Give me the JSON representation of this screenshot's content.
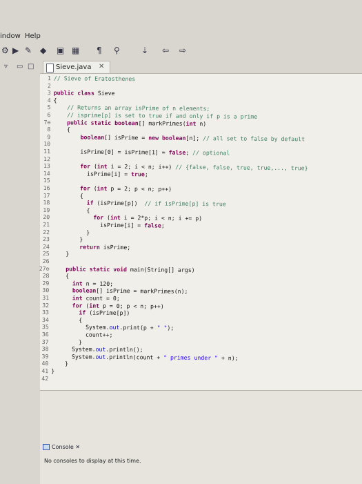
{
  "menu": {
    "window_label": "indow",
    "help_label": "Help"
  },
  "toolbar": {
    "icons": [
      "debug-icon",
      "run-icon",
      "new-icon",
      "pin-icon",
      "bookmark-icon",
      "pilcrow-icon",
      "search-icon",
      "annotation-icon",
      "back-icon",
      "forward-icon"
    ],
    "pilcrow": "¶"
  },
  "editor": {
    "tab_label": "Sieve.java",
    "tab_close": "✕"
  },
  "code_lines": [
    {
      "n": "1",
      "t": "// Sieve of Eratosthenes"
    },
    {
      "n": "2",
      "t": ""
    },
    {
      "n": "3",
      "t": "public class Sieve"
    },
    {
      "n": "4",
      "t": "{"
    },
    {
      "n": "5",
      "t": "    // Returns an array isPrime of n elements;"
    },
    {
      "n": "6",
      "t": "    // isprime[p] is set to true if and only if p is a prime"
    },
    {
      "n": "7⊖",
      "t": "    public static boolean[] markPrimes(int n)"
    },
    {
      "n": "8",
      "t": "    {"
    },
    {
      "n": "9",
      "t": "        boolean[] isPrime = new boolean[n]; // all set to false by default"
    },
    {
      "n": "10",
      "t": ""
    },
    {
      "n": "11",
      "t": "        isPrime[0] = isPrime[1] = false; // optional"
    },
    {
      "n": "12",
      "t": ""
    },
    {
      "n": "13",
      "t": "        for (int i = 2; i < n; i++) // {false, false, true, true,..., true}"
    },
    {
      "n": "14",
      "t": "          isPrime[i] = true;"
    },
    {
      "n": "15",
      "t": ""
    },
    {
      "n": "16",
      "t": "        for (int p = 2; p < n; p++)"
    },
    {
      "n": "17",
      "t": "        {"
    },
    {
      "n": "18",
      "t": "          if (isPrime[p])  // if isPrime[p] is true"
    },
    {
      "n": "19",
      "t": "          {"
    },
    {
      "n": "20",
      "t": "            for (int i = 2*p; i < n; i += p)"
    },
    {
      "n": "21",
      "t": "              isPrime[i] = false;"
    },
    {
      "n": "22",
      "t": "          }"
    },
    {
      "n": "23",
      "t": "        }"
    },
    {
      "n": "24",
      "t": "        return isPrime;"
    },
    {
      "n": "25",
      "t": "    }"
    },
    {
      "n": "26",
      "t": ""
    },
    {
      "n": "27⊖",
      "t": "    public static void main(String[] args)"
    },
    {
      "n": "28",
      "t": "    {"
    },
    {
      "n": "29",
      "t": "      int n = 120;"
    },
    {
      "n": "30",
      "t": "      boolean[] isPrime = markPrimes(n);"
    },
    {
      "n": "31",
      "t": "      int count = 0;"
    },
    {
      "n": "32",
      "t": "      for (int p = 0; p < n; p++)"
    },
    {
      "n": "33",
      "t": "        if (isPrime[p])"
    },
    {
      "n": "34",
      "t": "        {"
    },
    {
      "n": "35",
      "t": "          System.out.print(p + \" \");"
    },
    {
      "n": "36",
      "t": "          count++;"
    },
    {
      "n": "37",
      "t": "        }"
    },
    {
      "n": "38",
      "t": "      System.out.println();"
    },
    {
      "n": "39",
      "t": "      System.out.println(count + \" primes under \" + n);"
    },
    {
      "n": "40",
      "t": "    }"
    },
    {
      "n": "41",
      "t": "}"
    },
    {
      "n": "42",
      "t": ""
    }
  ],
  "console": {
    "tab_label": "Console",
    "tab_close": "✕",
    "message": "No consoles to display at this time."
  },
  "colors": {
    "keyword": "#7f0055",
    "comment": "#3f7f5f",
    "string": "#2a00ff",
    "field": "#0000c0"
  }
}
